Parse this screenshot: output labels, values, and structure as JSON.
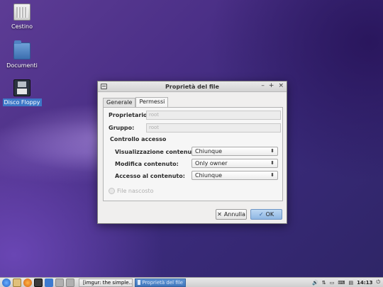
{
  "desktop": {
    "icons": [
      {
        "label": "Cestino"
      },
      {
        "label": "Documenti"
      },
      {
        "label": "Disco Floppy"
      }
    ]
  },
  "dialog": {
    "title": "Proprietà del file",
    "window_buttons": [
      "–",
      "+",
      "×"
    ],
    "tabs": [
      {
        "label": "Generale",
        "active": false
      },
      {
        "label": "Permessi",
        "active": true
      }
    ],
    "owner": {
      "label": "Proprietario:",
      "value": "root"
    },
    "group": {
      "label": "Gruppo:",
      "value": "root"
    },
    "access_section": "Controllo accesso",
    "view_content": {
      "label": "Visualizzazione contenuto:",
      "value": "Chiunque"
    },
    "modify_content": {
      "label": "Modifica contenuto:",
      "value": "Only owner"
    },
    "access_content": {
      "label": "Accesso al contenuto:",
      "value": "Chiunque"
    },
    "hidden_file": {
      "label": "File nascosto",
      "checked": false
    },
    "cancel_label": "Annulla",
    "ok_label": "OK"
  },
  "taskbar": {
    "tasks": [
      {
        "label": "[imgur: the simple...",
        "active": false
      },
      {
        "label": "Proprietà del file",
        "active": true
      }
    ],
    "clock": "14:13"
  },
  "colors": {
    "accent": "#3d78c8",
    "ok_button": "#a6c8ec"
  }
}
